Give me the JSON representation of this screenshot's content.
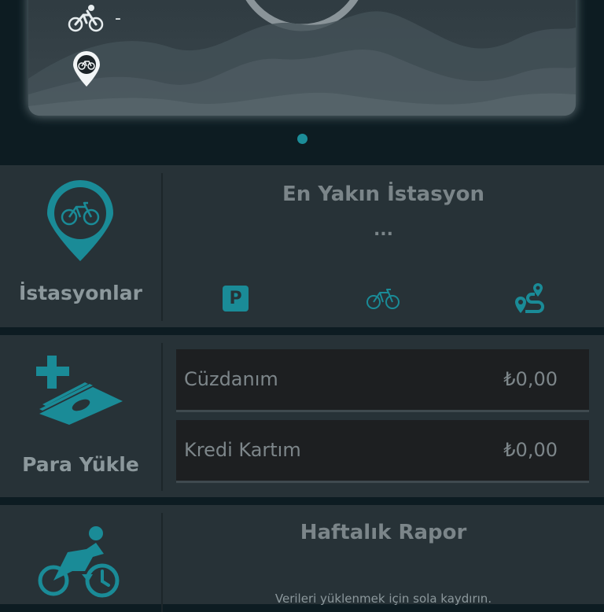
{
  "top": {
    "ride_value": "-"
  },
  "nearest": {
    "label": "İstasyonlar",
    "title": "En Yakın İstasyon",
    "value": "...",
    "parking_glyph": "P"
  },
  "wallet": {
    "label": "Para Yükle",
    "rows": [
      {
        "name": "Cüzdanım",
        "amount": "₺0,00"
      },
      {
        "name": "Kredi Kartım",
        "amount": "₺0,00"
      }
    ]
  },
  "report": {
    "title": "Haftalık Rapor",
    "hint": "Verileri yüklenmek için sola kaydırın."
  },
  "colors": {
    "accent": "#1c8d99",
    "panel": "#273237",
    "background": "#0d1c22"
  }
}
